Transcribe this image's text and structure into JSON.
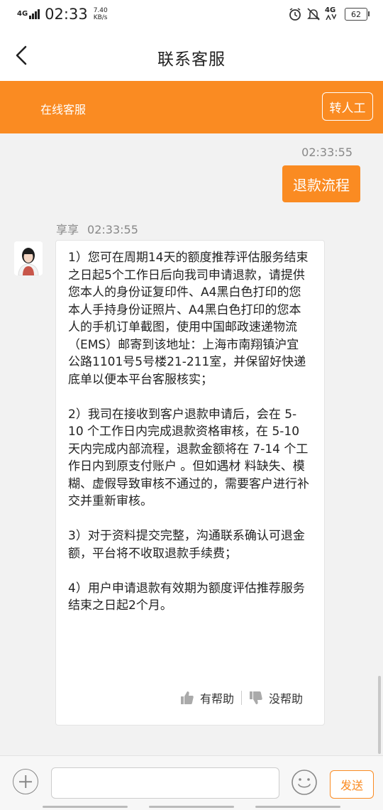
{
  "status_bar": {
    "network": "4G",
    "time": "02:33",
    "speed_value": "7.40",
    "speed_unit": "KB/s",
    "network_right": "4G",
    "battery": "62"
  },
  "nav": {
    "title": "联系客服"
  },
  "service_bar": {
    "label": "在线客服",
    "transfer_label": "转人工"
  },
  "chat": {
    "user_time": "02:33:55",
    "user_message": "退款流程",
    "agent_name": "享享",
    "agent_time": "02:33:55",
    "agent_message": "1）您可在周期14天的额度推荐评估服务结束之日起5个工作日后向我司申请退款，请提供您本人的身份证复印件、A4黑白色打印的您本人手持身份证照片、A4黑白色打印的您本人的手机订单截图，使用中国邮政速递物流（EMS）邮寄到该地址：上海市南翔镇沪宜公路1101号5号楼21-211室，并保留好快递底单以便本平台客服核实；\n\n2）我司在接收到客户退款申请后，会在 5-10 个工作日内完成退款资格审核，在 5-10 天内完成内部流程，退款金额将在 7-14 个工作日内到原支付账户 。但如遇材 料缺失、模糊、虚假导致审核不通过的，需要客户进行补交并重新审核。\n\n3）对于资料提交完整，沟通联系确认可退金额，平台将不收取退款手续费；\n\n4）用户申请退款有效期为额度评估推荐服务结束之日起2个月。",
    "helpful_label": "有帮助",
    "not_helpful_label": "没帮助"
  },
  "input_bar": {
    "placeholder": "",
    "send_label": "发送"
  },
  "colors": {
    "accent": "#fa8b22"
  }
}
